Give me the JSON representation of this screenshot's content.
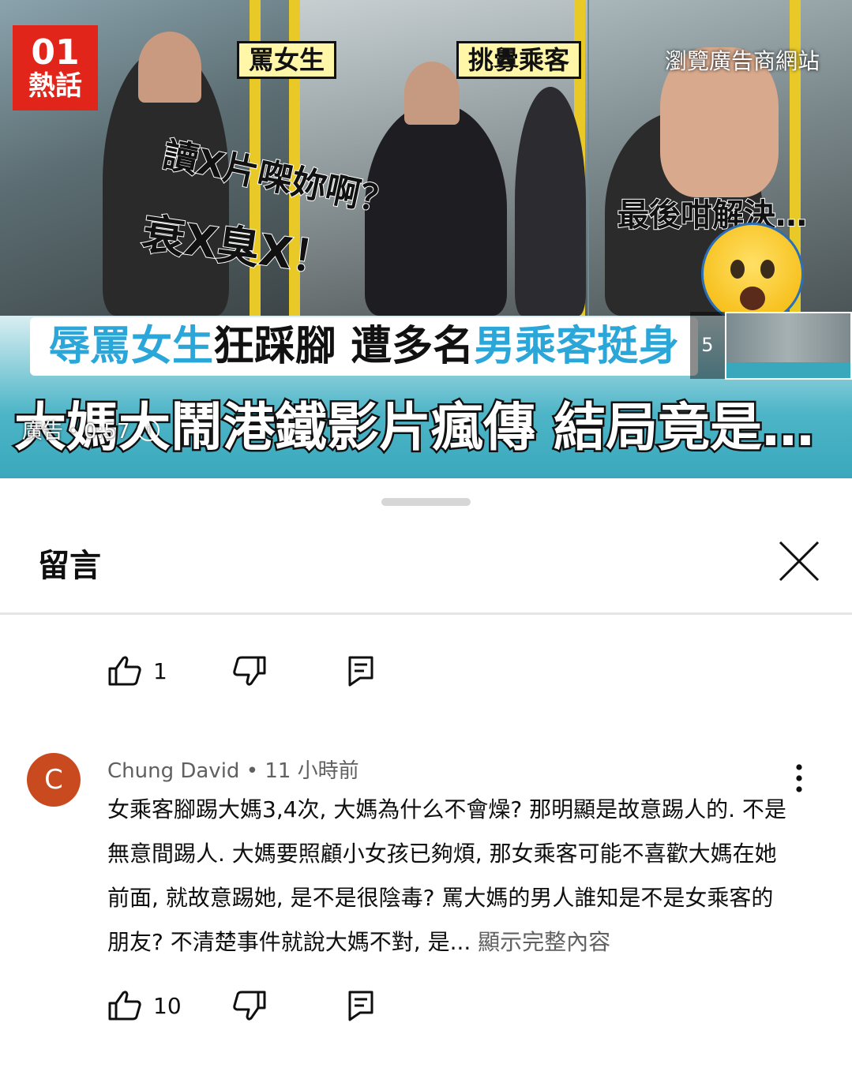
{
  "video": {
    "logo_number": "01",
    "logo_text": "熱話",
    "tag_left": "罵女生",
    "tag_middle": "挑釁乘客",
    "ad_site_label": "瀏覽廣告商網站",
    "caption_line1": "讀X片㗎妳啊？",
    "caption_line2": "衰X臭X！",
    "caption_right": "最後咁解決…",
    "headline_part1_blue": "辱罵女生",
    "headline_part2": "狂踩腳 遭多名",
    "headline_part3_blue": "男乘客挺身",
    "headline_bottom": "大媽大鬧港鐵影片瘋傳 結局竟是…",
    "ad_counter": "廣告・0:57",
    "info_icon": "i",
    "thumb_count": "5"
  },
  "sheet": {
    "title": "留言"
  },
  "comment_prev": {
    "like_count": "1"
  },
  "comment": {
    "avatar_letter": "C",
    "author": "Chung David",
    "separator": " • ",
    "time": "11 小時前",
    "text": "女乘客腳踢大媽3,4次, 大媽為什么不會燥? 那明顯是故意踢人的. 不是無意間踢人. 大媽要照顧小女孩已夠煩, 那女乘客可能不喜歡大媽在她前面, 就故意踢她, 是不是很陰毒? 罵大媽的男人誰知是不是女乘客的朋友? 不清楚事件就說大媽不對, 是...",
    "show_more": "顯示完整內容",
    "like_count": "10"
  },
  "colors": {
    "avatar": "#c94a1f",
    "logo": "#e1251b",
    "headline_blue": "#2aa6d8",
    "tag_bg": "#fff6a8"
  }
}
